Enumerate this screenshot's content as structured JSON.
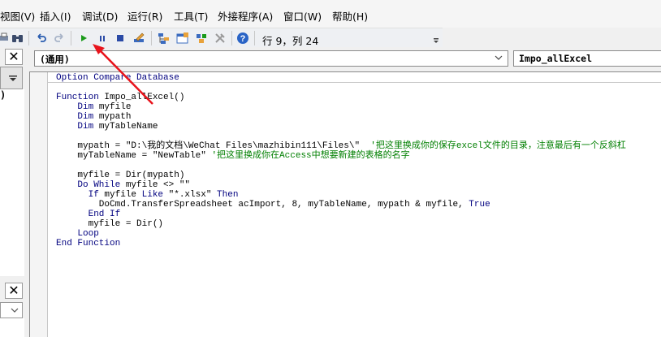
{
  "menu": {
    "items": [
      "视图(V)",
      "插入(I)",
      "调试(D)",
      "运行(R)",
      "工具(T)",
      "外接程序(A)",
      "窗口(W)",
      "帮助(H)"
    ]
  },
  "toolbar": {
    "cursor_position": "行 9，列 24",
    "icons": [
      "find-icon",
      "undo-icon",
      "redo-icon",
      "run-icon",
      "break-icon",
      "reset-icon",
      "design-mode-icon",
      "project-explorer-icon",
      "properties-window-icon",
      "object-browser-icon",
      "toolbox-icon",
      "help-icon"
    ]
  },
  "left_panes": {
    "top_close": "✕",
    "bottom_close": "✕",
    "top_fragment": ")"
  },
  "code_window": {
    "object_combo": "(通用)",
    "procedure_combo": "Impo_allExcel",
    "lines": [
      {
        "code": "Option Compare Database",
        "comment": ""
      },
      {
        "code": "",
        "comment": ""
      },
      {
        "code": "Function Impo_allExcel()",
        "comment": ""
      },
      {
        "code": "    Dim myfile",
        "comment": ""
      },
      {
        "code": "    Dim mypath",
        "comment": ""
      },
      {
        "code": "    Dim myTableName",
        "comment": ""
      },
      {
        "code": "",
        "comment": ""
      },
      {
        "code": "    mypath = \"D:\\我的文档\\WeChat Files\\mazhibin111\\Files\\\"  ",
        "comment": "'把这里换成你的保存excel文件的目录，注意最后有一个反斜杠"
      },
      {
        "code": "    myTableName = \"NewTable\" ",
        "comment": "'把这里换成你在Access中想要新建的表格的名字"
      },
      {
        "code": "",
        "comment": ""
      },
      {
        "code": "    myfile = Dir(mypath)",
        "comment": ""
      },
      {
        "code": "    Do While myfile <> \"\"",
        "comment": ""
      },
      {
        "code": "      If myfile Like \"*.xlsx\" Then",
        "comment": ""
      },
      {
        "code": "        DoCmd.TransferSpreadsheet acImport, 8, myTableName, mypath & myfile, True",
        "comment": ""
      },
      {
        "code": "      End If",
        "comment": ""
      },
      {
        "code": "      myfile = Dir()",
        "comment": ""
      },
      {
        "code": "    Loop",
        "comment": ""
      },
      {
        "code": "End Function",
        "comment": ""
      }
    ]
  },
  "colors": {
    "keyword": "#00007f",
    "comment": "#007f00",
    "run_icon": "#1a9a1a",
    "annotation_arrow": "#e8141c"
  }
}
